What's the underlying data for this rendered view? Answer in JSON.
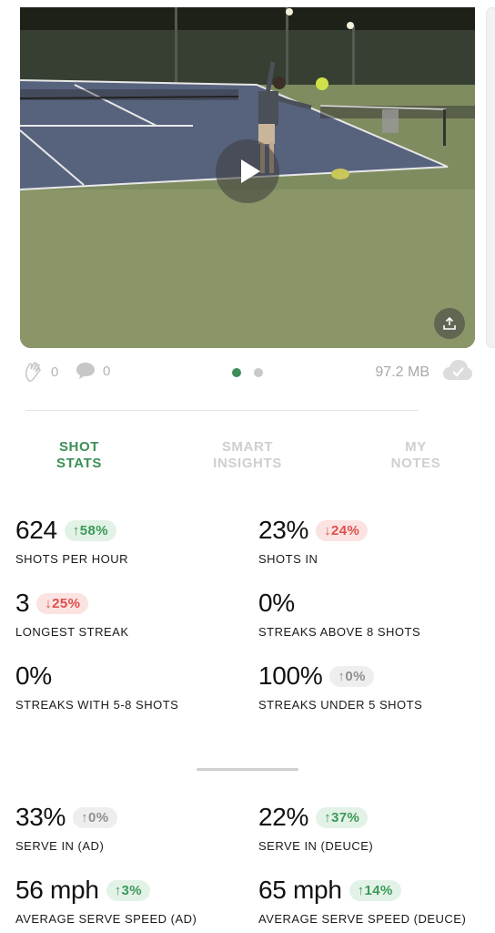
{
  "media": {
    "likes": "0",
    "comments": "0",
    "size": "97.2 MB",
    "page_dots": [
      {
        "active": true,
        "color": "#3e8e57"
      },
      {
        "active": false,
        "color": "#c9c9c9"
      }
    ]
  },
  "tabs": [
    {
      "line1": "SHOT",
      "line2": "STATS",
      "active": true
    },
    {
      "line1": "SMART",
      "line2": "INSIGHTS",
      "active": false
    },
    {
      "line1": "MY",
      "line2": "NOTES",
      "active": false
    }
  ],
  "stats": {
    "shots_per_hour": {
      "value": "624",
      "badge": "↑58%",
      "trend": "up",
      "label": "SHOTS PER HOUR"
    },
    "shots_in": {
      "value": "23%",
      "badge": "↓24%",
      "trend": "down",
      "label": "SHOTS IN"
    },
    "longest_streak": {
      "value": "3",
      "badge": "↓25%",
      "trend": "down",
      "label": "LONGEST STREAK"
    },
    "streaks_above_8": {
      "value": "0%",
      "label": "STREAKS ABOVE 8 SHOTS"
    },
    "streaks_5_8": {
      "value": "0%",
      "label": "STREAKS WITH 5-8 SHOTS"
    },
    "streaks_under_5": {
      "value": "100%",
      "badge": "↑0%",
      "trend": "flat",
      "label": "STREAKS UNDER 5 SHOTS"
    }
  },
  "serve_stats": {
    "serve_in_ad": {
      "value": "33%",
      "badge": "↑0%",
      "trend": "flat",
      "label": "SERVE IN (AD)"
    },
    "serve_in_deuce": {
      "value": "22%",
      "badge": "↑37%",
      "trend": "up",
      "label": "SERVE IN (DEUCE)"
    },
    "avg_speed_ad": {
      "value": "56 mph",
      "badge": "↑3%",
      "trend": "up",
      "label": "AVERAGE SERVE SPEED (AD)"
    },
    "avg_speed_deuce": {
      "value": "65 mph",
      "badge": "↑14%",
      "trend": "up",
      "label": "AVERAGE SERVE SPEED (DEUCE)"
    }
  },
  "colors": {
    "accent_green": "#3e8e57",
    "badge_up_bg": "#e3f2e6",
    "badge_down_bg": "#fbe3e2",
    "badge_flat_bg": "#eeeeee"
  },
  "icons": {
    "clap": "clap-icon",
    "comment": "comment-icon",
    "cloud": "cloud-check-icon",
    "play": "play-icon",
    "share": "share-icon"
  }
}
